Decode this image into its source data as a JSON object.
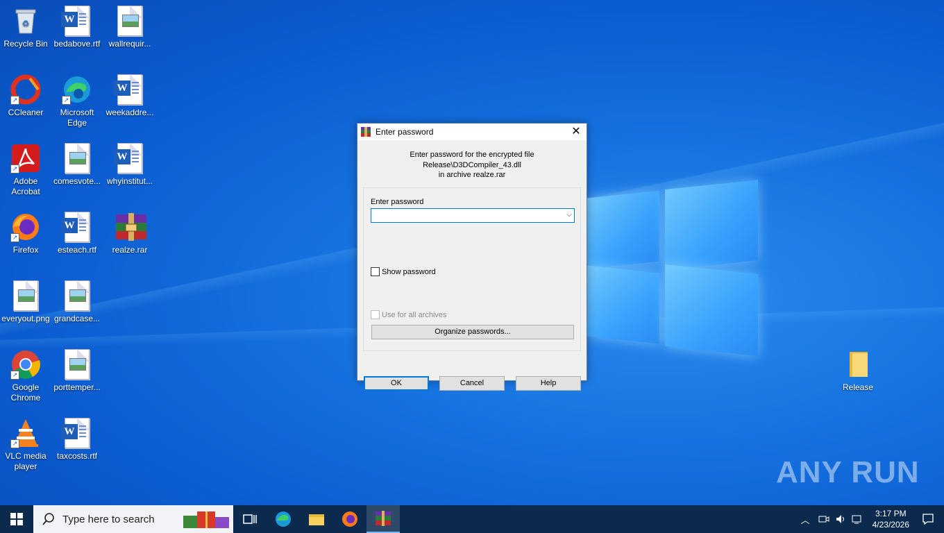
{
  "desktop": {
    "icons": [
      {
        "label": "Recycle Bin",
        "icon": "recycle-bin-icon"
      },
      {
        "label": "bedabove.rtf",
        "icon": "word-document-icon"
      },
      {
        "label": "wallrequir...",
        "icon": "image-file-icon"
      },
      {
        "label": "CCleaner",
        "icon": "ccleaner-icon"
      },
      {
        "label": "Microsoft Edge",
        "icon": "edge-icon"
      },
      {
        "label": "weekaddre...",
        "icon": "word-document-icon"
      },
      {
        "label": "Adobe Acrobat",
        "icon": "acrobat-icon"
      },
      {
        "label": "comesvote...",
        "icon": "image-file-icon"
      },
      {
        "label": "whyinstitut...",
        "icon": "word-document-icon"
      },
      {
        "label": "Firefox",
        "icon": "firefox-icon"
      },
      {
        "label": "esteach.rtf",
        "icon": "word-document-icon"
      },
      {
        "label": "realze.rar",
        "icon": "winrar-archive-icon"
      },
      {
        "label": "everyout.png",
        "icon": "image-file-icon"
      },
      {
        "label": "grandcase...",
        "icon": "image-file-icon"
      },
      {
        "label": "Google Chrome",
        "icon": "chrome-icon"
      },
      {
        "label": "porttemper...",
        "icon": "image-file-icon"
      },
      {
        "label": "VLC media player",
        "icon": "vlc-icon"
      },
      {
        "label": "taxcosts.rtf",
        "icon": "word-document-icon"
      },
      {
        "label": "Release",
        "icon": "folder-icon"
      }
    ]
  },
  "dialog": {
    "title": "Enter password",
    "message_line1": "Enter password for the encrypted file",
    "message_line2": "Release\\D3DCompiler_43.dll",
    "message_line3": "in archive realze.rar",
    "password_label": "Enter password",
    "password_value": "",
    "show_password_label": "Show password",
    "show_password_checked": false,
    "use_for_all_label": "Use for all archives",
    "use_for_all_enabled": false,
    "organize_label": "Organize passwords...",
    "ok_label": "OK",
    "cancel_label": "Cancel",
    "help_label": "Help"
  },
  "taskbar": {
    "search_placeholder": "Type here to search",
    "time": "3:17 PM",
    "date": "4/23/2026"
  },
  "watermark": "ANY RUN"
}
